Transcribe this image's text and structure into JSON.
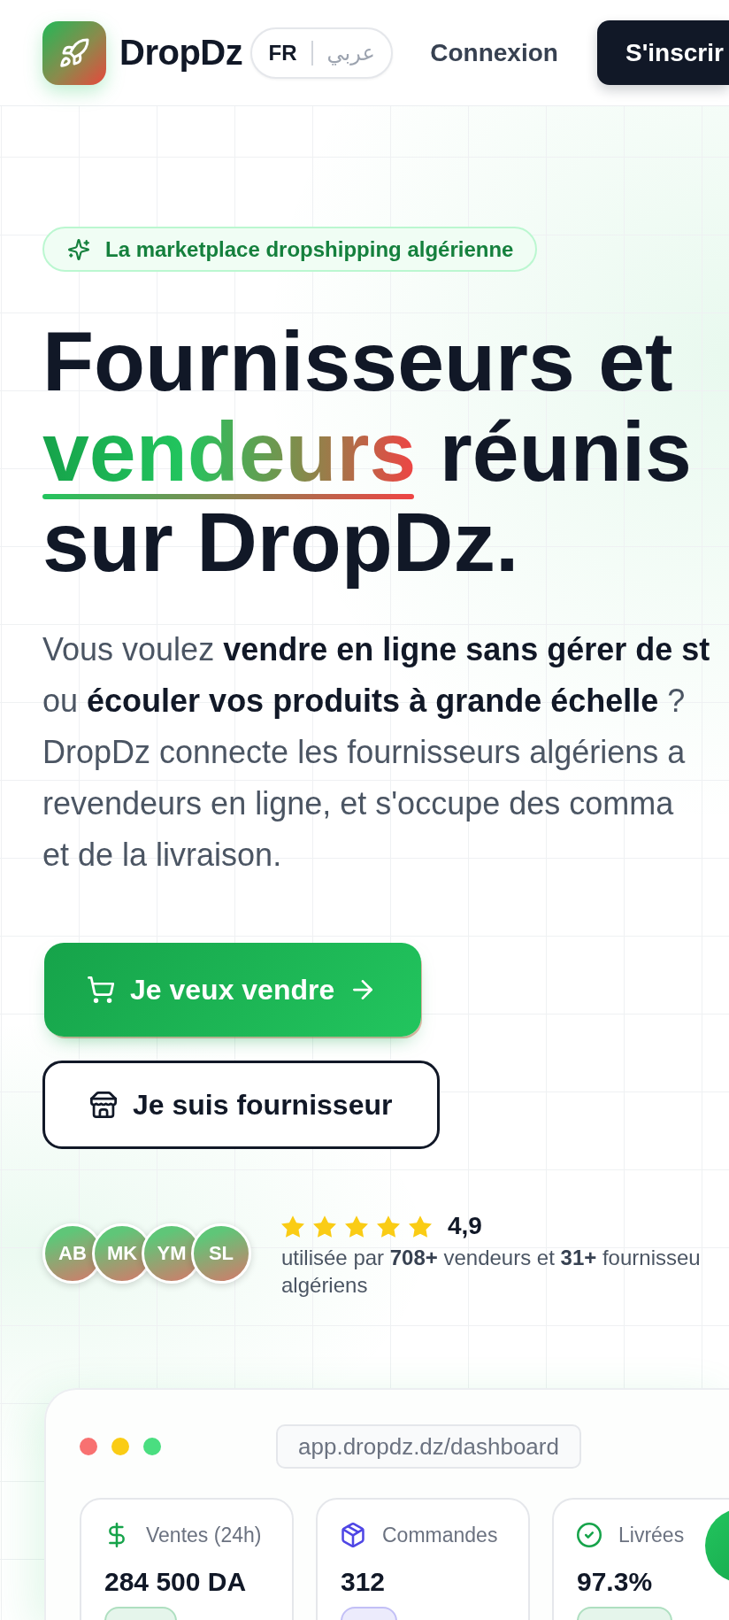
{
  "header": {
    "brand": "DropDz",
    "languages": [
      {
        "label": "FR",
        "selected": true
      },
      {
        "label": "عربي",
        "selected": false
      }
    ],
    "login": "Connexion",
    "signup": "S'inscrir"
  },
  "hero": {
    "badge": "La marketplace dropshipping algérienne",
    "headline": [
      {
        "text": "Fournisseurs et",
        "highlight": false
      },
      {
        "text": "vendeurs",
        "highlight": true
      },
      {
        "text": "réunis sur DropDz.",
        "highlight": false
      }
    ],
    "intro_lines": [
      "Vous voulez **vendre en ligne sans gérer de st**",
      "ou **écouler vos produits à grande échelle** ?",
      "DropDz connecte les fournisseurs algériens a",
      "revendeurs en ligne, et s'occupe des comma",
      "et de la livraison."
    ],
    "actions": [
      {
        "kind": "primary",
        "label": "Je veux vendre"
      },
      {
        "kind": "outline",
        "label": "Je suis fournisseur"
      }
    ],
    "social_proof": {
      "avatars": [
        "AB",
        "MK",
        "YM",
        "SL"
      ],
      "stars": 5,
      "rating": "4,9",
      "text_lines": [
        "utilisée par **708+** vendeurs et **31+** fournisseu",
        "algériens"
      ]
    }
  },
  "dashboard": {
    "window_dots": [
      {
        "color": "#f87171"
      },
      {
        "color": "#facc15"
      },
      {
        "color": "#4ade80"
      }
    ],
    "url": "app.dropdz.dz/dashboard",
    "stats": [
      {
        "kind": "revenue",
        "label": "Ventes (24h)",
        "value": "284 500 DA",
        "color": "#16a34a"
      },
      {
        "kind": "orders",
        "label": "Commandes",
        "value": "312",
        "color": "#4f46e5"
      },
      {
        "kind": "delivered",
        "label": "Livrées",
        "value": "97.3%",
        "color": "#16a34a"
      }
    ]
  }
}
